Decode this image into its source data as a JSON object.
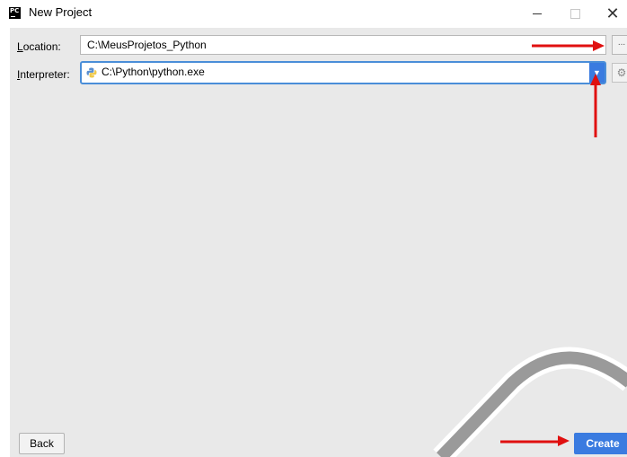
{
  "window": {
    "title": "New Project",
    "app_icon_text": "PC",
    "close_glyph": "✕"
  },
  "form": {
    "location_label_first": "L",
    "location_label_rest": "ocation:",
    "location_value": "C:\\MeusProjetos_Python",
    "browse_label": "...",
    "interpreter_label_first": "I",
    "interpreter_label_rest": "nterpreter:",
    "interpreter_value": "C:\\Python\\python.exe",
    "dropdown_glyph": "▼",
    "gear_glyph": "⚙"
  },
  "buttons": {
    "back_label": "Back",
    "create_label": "Create"
  },
  "colors": {
    "accent_blue": "#3a7be0",
    "annotation_red": "#e01010",
    "panel_bg": "#e9e9e9"
  },
  "icons": [
    "pycharm-app-icon",
    "minimize-icon",
    "maximize-icon",
    "close-icon",
    "python-icon",
    "chevron-down-icon",
    "gear-icon"
  ]
}
